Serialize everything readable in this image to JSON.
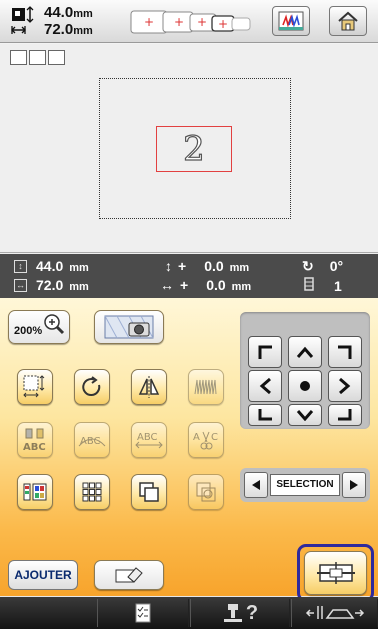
{
  "topbar": {
    "width_value": "44.0",
    "height_value": "72.0",
    "unit": "mm"
  },
  "status": {
    "height_value": "44.0",
    "width_value": "72.0",
    "offset_v_value": "0.0",
    "offset_h_value": "0.0",
    "unit": "mm",
    "rotation": "0°",
    "color_count": "1",
    "plus": "+"
  },
  "preview": {
    "pattern_character": "2"
  },
  "zoom": {
    "label": "200%"
  },
  "selection": {
    "label": "SELECTION"
  },
  "add_button": {
    "label": "AJOUTER"
  },
  "footer": {
    "help_mark": "?"
  },
  "colors": {
    "panel_top": "#fff7d8",
    "panel_bottom": "#f7a42c",
    "status_bg": "#4b4b4b",
    "focus": "#2f2a9c",
    "pattern_frame": "#e24040"
  }
}
